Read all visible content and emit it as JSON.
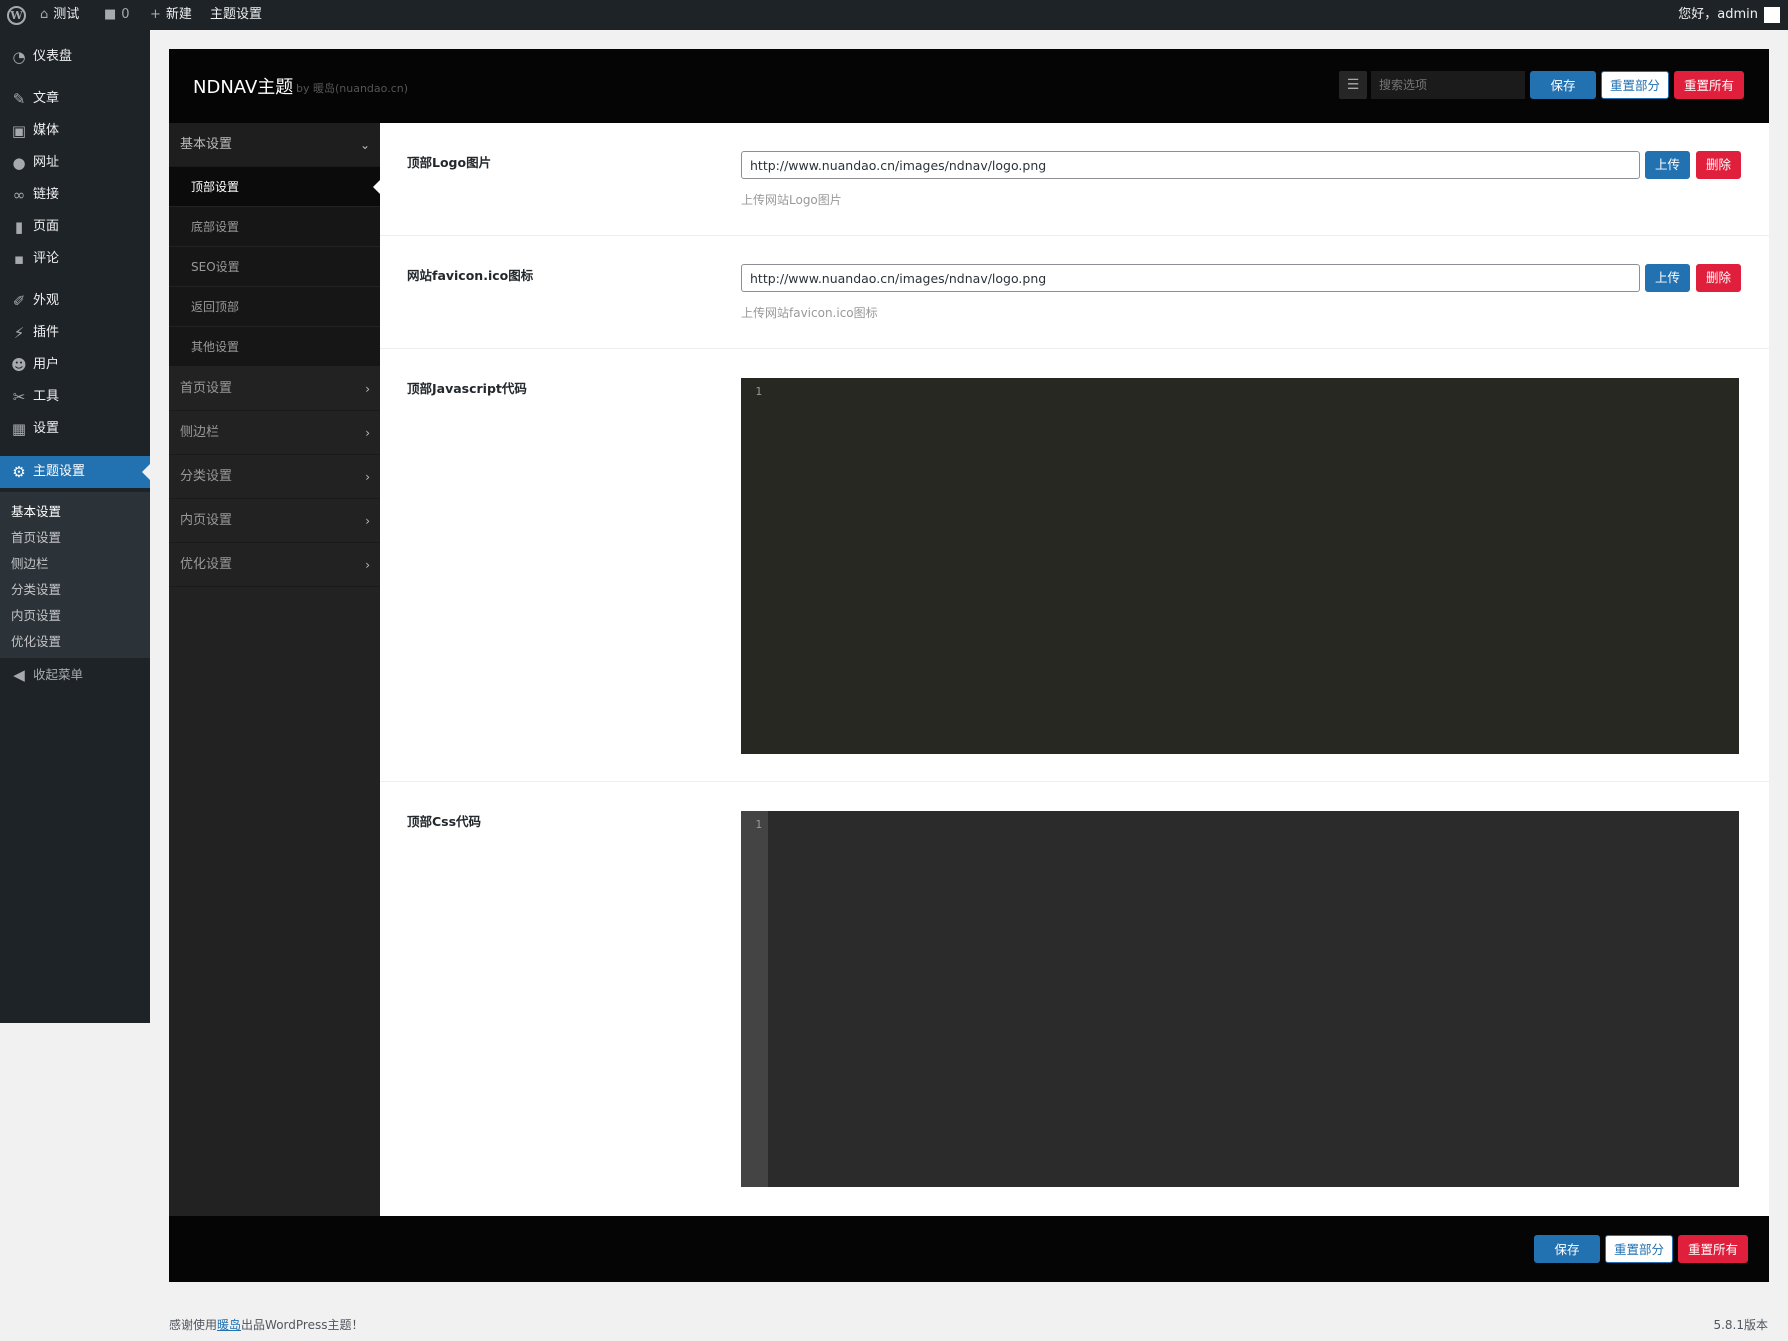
{
  "admin_bar": {
    "site_name": "测试",
    "comments_count": "0",
    "new_label": "新建",
    "theme_settings_label": "主题设置",
    "greeting": "您好，admin"
  },
  "admin_menu": {
    "items": [
      {
        "label": "仪表盘",
        "icon": "dashboard-icon"
      },
      {
        "label": "文章",
        "icon": "pin-icon"
      },
      {
        "label": "媒体",
        "icon": "media-icon"
      },
      {
        "label": "网址",
        "icon": "globe-icon"
      },
      {
        "label": "链接",
        "icon": "link-icon"
      },
      {
        "label": "页面",
        "icon": "page-icon"
      },
      {
        "label": "评论",
        "icon": "comment-icon"
      },
      {
        "label": "外观",
        "icon": "brush-icon"
      },
      {
        "label": "插件",
        "icon": "plugin-icon"
      },
      {
        "label": "用户",
        "icon": "user-icon"
      },
      {
        "label": "工具",
        "icon": "wrench-icon"
      },
      {
        "label": "设置",
        "icon": "settings-icon"
      },
      {
        "label": "主题设置",
        "icon": "gear-icon"
      }
    ],
    "submenu": [
      "基本设置",
      "首页设置",
      "侧边栏",
      "分类设置",
      "内页设置",
      "优化设置"
    ],
    "collapse_label": "收起菜单"
  },
  "panel": {
    "title": "NDNAV主题",
    "subtitle": "by 暖岛(nuandao.cn)",
    "search_placeholder": "搜索选项",
    "save_label": "保存",
    "reset_section_label": "重置部分",
    "reset_all_label": "重置所有"
  },
  "nav": {
    "basic": {
      "label": "基本设置"
    },
    "basic_subs": [
      "顶部设置",
      "底部设置",
      "SEO设置",
      "返回顶部",
      "其他设置"
    ],
    "sections": [
      "首页设置",
      "侧边栏",
      "分类设置",
      "内页设置",
      "优化设置"
    ]
  },
  "fields": {
    "logo": {
      "title": "顶部Logo图片",
      "value": "http://www.nuandao.cn/images/ndnav/logo.png",
      "upload_label": "上传",
      "delete_label": "删除",
      "desc": "上传网站Logo图片"
    },
    "favicon": {
      "title": "网站favicon.ico图标",
      "value": "http://www.nuandao.cn/images/ndnav/logo.png",
      "upload_label": "上传",
      "delete_label": "删除",
      "desc": "上传网站favicon.ico图标"
    },
    "js": {
      "title": "顶部Javascript代码",
      "line": "1"
    },
    "css": {
      "title": "顶部Css代码",
      "line": "1"
    }
  },
  "footer": {
    "thanks_prefix": "感谢使用",
    "thanks_link": "暖岛",
    "thanks_suffix": "出品WordPress主题！",
    "version": "5.8.1版本"
  },
  "colors": {
    "accent_blue": "#2271b1",
    "danger_red": "#e01f3c",
    "admin_dark": "#1d2327",
    "panel_black": "#050505",
    "js_editor_bg": "#272822",
    "css_editor_bg": "#2b2b2b"
  }
}
